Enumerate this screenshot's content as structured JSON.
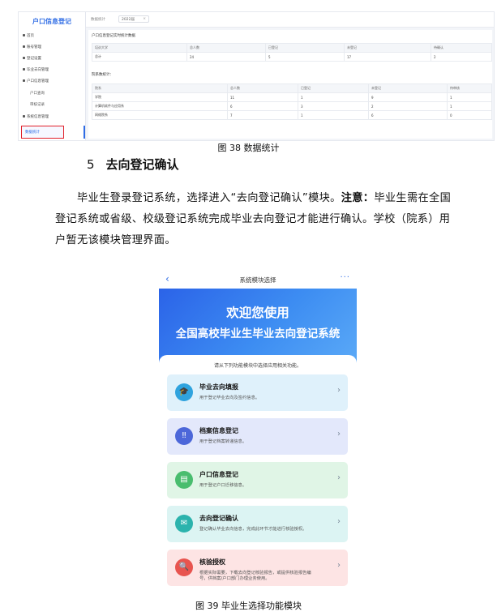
{
  "admin": {
    "logo": "户口信息登记",
    "sidebar": [
      "首页",
      "账号管理",
      "登记设置",
      "毕业去向管理",
      "户口信息管理",
      "户口查询",
      "审核记录",
      "系统信息管理",
      "数据统计"
    ],
    "active_item": "数据统计",
    "filter_label": "数据统计",
    "year_tag": "2022届",
    "close_glyph": "×",
    "section1_title": "户口信息登记实时统计数据",
    "table1": {
      "headers": [
        "培训大学",
        "总人数",
        "已登记",
        "未登记",
        "待确认"
      ],
      "rows": [
        [
          "总计",
          "24",
          "5",
          "17",
          "2"
        ]
      ]
    },
    "section2_title": "院系数统计：",
    "table2": {
      "headers": [
        "院系",
        "总人数",
        "已登记",
        "未登记",
        "待审核"
      ],
      "rows": [
        [
          "学院",
          "11",
          "1",
          "9",
          "1"
        ],
        [
          "计算机软件与应用系",
          "6",
          "3",
          "2",
          "1"
        ],
        [
          "网络院系",
          "7",
          "1",
          "6",
          "0"
        ]
      ]
    }
  },
  "caption38": "图 38 数据统计",
  "section": {
    "number": "5",
    "title": "去向登记确认"
  },
  "paragraph": {
    "part1": "毕业生登录登记系统，选择进入“去向登记确认”模块。",
    "bold": "注意：",
    "part2": "毕业生需在全国登记系统或省级、校级登记系统完成毕业去向登记才能进行确认。学校（院系）用户暂无该模块管理界面。"
  },
  "phone": {
    "nav_title": "系统模块选择",
    "back_glyph": "‹",
    "more_glyph": "···",
    "banner_line1": "欢迎您使用",
    "banner_line2": "全国高校毕业生毕业去向登记系统",
    "hint": "请从下列功能模块中选择应用相关功能。",
    "cards": [
      {
        "title": "毕业去向填报",
        "desc": "用于登记毕业去向及签约信息。",
        "desc2": "",
        "icon": "graduation-cap-icon",
        "icon_glyph": "🎓",
        "bg": "#dff1fb",
        "icon_color": "#2fa3de"
      },
      {
        "title": "档案信息登记",
        "desc": "用于登记档案转递信息。",
        "desc2": "",
        "icon": "archive-icon",
        "icon_glyph": "‼",
        "bg": "#e3e8fb",
        "icon_color": "#4c67d9"
      },
      {
        "title": "户口信息登记",
        "desc": "用于登记户口迁移信息。",
        "desc2": "",
        "icon": "id-card-icon",
        "icon_glyph": "▤",
        "bg": "#e0f5e6",
        "icon_color": "#49bd6e"
      },
      {
        "title": "去向登记确认",
        "desc": "登记确认毕业去向信息，完成此环节才能进行核验授权。",
        "desc2": "",
        "icon": "envelope-icon",
        "icon_glyph": "✉",
        "bg": "#dcf4f3",
        "icon_color": "#2bb3ad"
      },
      {
        "title": "核验授权",
        "desc": "根据实际需要，下载去向登记核验报告，或提供核验报告编",
        "desc2": "号，供档案/户口部门办理业务使用。",
        "icon": "verify-icon",
        "icon_glyph": "🔍",
        "bg": "#fde4e4",
        "icon_color": "#e8544f"
      }
    ],
    "chevron": "›"
  },
  "caption39": "图 39 毕业生选择功能模块"
}
